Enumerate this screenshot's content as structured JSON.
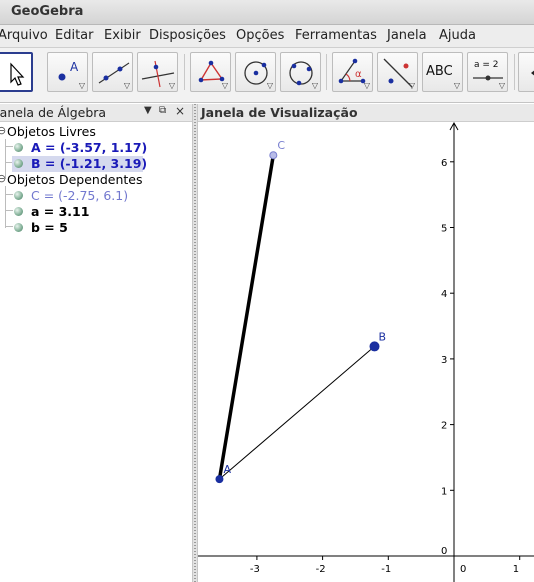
{
  "app": {
    "title": "GeoGebra"
  },
  "menu": [
    "Arquivo",
    "Editar",
    "Exibir",
    "Disposições",
    "Opções",
    "Ferramentas",
    "Janela",
    "Ajuda"
  ],
  "toolbar": {
    "tools": [
      {
        "name": "move-tool-button",
        "icon": "arrow-cursor-icon",
        "selected": true
      },
      {
        "name": "point-tool-button",
        "icon": "point-icon",
        "label": "A"
      },
      {
        "name": "line-tool-button",
        "icon": "line-icon"
      },
      {
        "name": "perpendicular-tool-button",
        "icon": "perpendicular-icon"
      },
      {
        "name": "polygon-tool-button",
        "icon": "polygon-icon"
      },
      {
        "name": "circle-tool-button",
        "icon": "circle-center-icon"
      },
      {
        "name": "circle-points-tool-button",
        "icon": "circle-three-points-icon"
      },
      {
        "name": "angle-tool-button",
        "icon": "angle-icon",
        "label": "α"
      },
      {
        "name": "reflect-tool-button",
        "icon": "reflect-icon"
      },
      {
        "name": "text-tool-button",
        "icon": "text-icon",
        "label": "ABC"
      },
      {
        "name": "slider-tool-button",
        "icon": "slider-icon",
        "label": "a = 2"
      }
    ]
  },
  "algebra": {
    "header": "Janela de Álgebra",
    "free_group": "Objetos Livres",
    "dependent_group": "Objetos Dependentes",
    "free": [
      {
        "text": "A = (-3.57, 1.17)",
        "style": "blue",
        "selected": false
      },
      {
        "text": "B = (-1.21, 3.19)",
        "style": "blue",
        "selected": true
      }
    ],
    "dependent": [
      {
        "text": "C = (-2.75, 6.1)",
        "style": "grey"
      },
      {
        "text": "a = 3.11",
        "style": "black"
      },
      {
        "text": "b = 5",
        "style": "black"
      }
    ]
  },
  "graphics": {
    "header": "Janela de Visualização",
    "x_ticks": [
      "-3",
      "-2",
      "-1",
      "0",
      "1"
    ],
    "y_ticks": [
      "0",
      "1",
      "2",
      "3",
      "4",
      "5",
      "6"
    ],
    "points": [
      {
        "label": "A",
        "x": -3.57,
        "y": 1.17
      },
      {
        "label": "B",
        "x": -1.21,
        "y": 3.19
      },
      {
        "label": "C",
        "x": -2.75,
        "y": 6.1
      }
    ],
    "segments": [
      {
        "from": "A",
        "to": "C",
        "thick": true
      },
      {
        "from": "A",
        "to": "B",
        "thick": false
      }
    ],
    "colors": {
      "point": "#1a2fa0",
      "point_c": "#7a80d0",
      "axis": "#000000"
    }
  }
}
